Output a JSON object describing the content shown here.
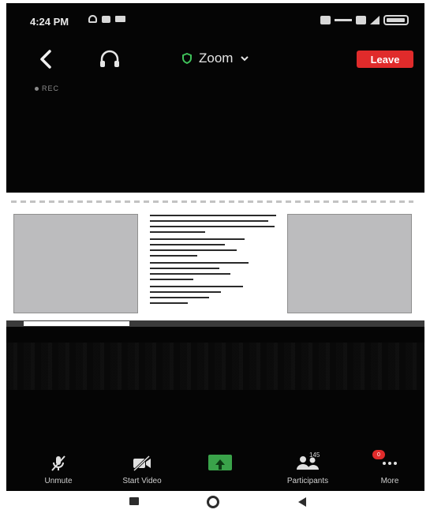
{
  "status_bar": {
    "time": "4:24 PM",
    "icons_left": [
      "headset-icon",
      "cast-icon",
      "video-icon"
    ],
    "icons_right": [
      "sim-icon",
      "signal-icon",
      "battery-icon"
    ]
  },
  "header": {
    "back_icon": "chevron-left-icon",
    "audio_icon": "headphones-icon",
    "title": "Zoom",
    "title_icon": "shield-icon",
    "leave_label": "Leave",
    "leave_color": "#e02b2b"
  },
  "recording": {
    "label": "REC"
  },
  "toolbar": {
    "items": [
      {
        "label": "Unmute",
        "icon": "microphone-muted-icon"
      },
      {
        "label": "Start Video",
        "icon": "video-off-icon"
      },
      {
        "label": "",
        "icon": "share-icon",
        "color": "#3aa34a"
      },
      {
        "label": "Participants",
        "icon": "participants-icon",
        "count": "145"
      },
      {
        "label": "More",
        "icon": "more-icon",
        "badge": "0"
      }
    ]
  },
  "nav_bar": {
    "items": [
      "recent-apps-icon",
      "home-icon",
      "back-icon"
    ]
  }
}
